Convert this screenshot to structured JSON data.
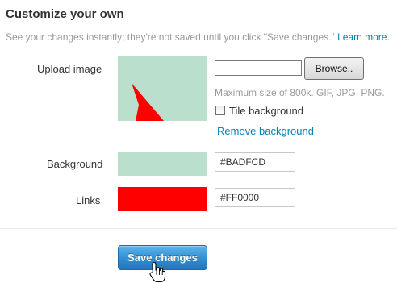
{
  "header": {
    "title": "Customize your own",
    "subtitle": "See your changes instantly; they're not saved until you click \"Save changes.\"",
    "learn_more": "Learn more."
  },
  "upload": {
    "label": "Upload image",
    "browse_label": "Browse..",
    "file_value": "",
    "hint": "Maximum size of 800k. GIF, JPG, PNG.",
    "tile_label": "Tile background",
    "tile_checked": false,
    "remove_label": "Remove background"
  },
  "background": {
    "label": "Background",
    "value": "#BADFCD",
    "color": "#BADFCD"
  },
  "links": {
    "label": "Links",
    "value": "#FF0000",
    "color": "#FF0000"
  },
  "actions": {
    "save_label": "Save changes"
  },
  "icons": {
    "cursor": "hand-pointer-icon"
  }
}
